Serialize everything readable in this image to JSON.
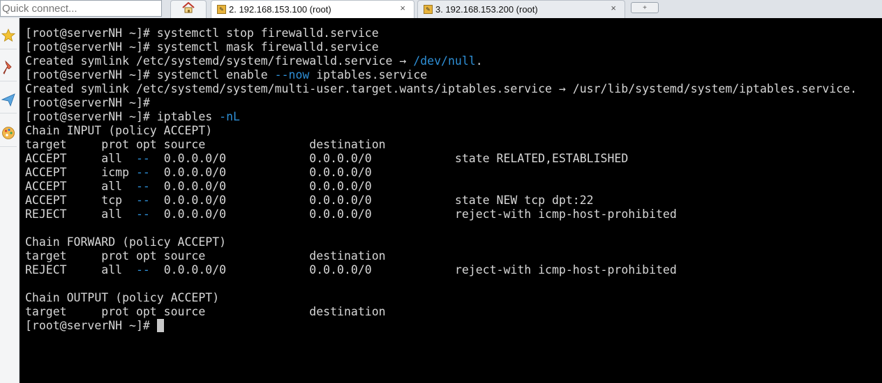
{
  "quick_connect": {
    "placeholder": "Quick connect..."
  },
  "tabs": [
    {
      "label": "2. 192.168.153.100 (root)",
      "close": "×",
      "active": true
    },
    {
      "label": "3. 192.168.153.200 (root)",
      "close": "×",
      "active": false
    }
  ],
  "new_tab_icon": "+",
  "sidebar": {
    "icons": [
      "star-icon",
      "pin-icon",
      "send-icon",
      "palette-icon"
    ]
  },
  "terminal": {
    "prompt": "[root@serverNH ~]# ",
    "lines": [
      {
        "t": "prompt_cmd",
        "cmd": "systemctl stop firewalld.service"
      },
      {
        "t": "prompt_cmd",
        "cmd": "systemctl mask firewalld.service"
      },
      {
        "t": "plain",
        "text": "Created symlink /etc/systemd/system/firewalld.service → ",
        "blue": "/dev/null",
        "after": "."
      },
      {
        "t": "prompt_cmd",
        "cmd_pre": "systemctl enable ",
        "blue": "--now",
        "cmd_post": " iptables.service"
      },
      {
        "t": "plain",
        "text": "Created symlink /etc/systemd/system/multi-user.target.wants/iptables.service → /usr/lib/systemd/system/iptables.service."
      },
      {
        "t": "prompt_cmd",
        "cmd": ""
      },
      {
        "t": "prompt_cmd",
        "cmd_pre": "iptables ",
        "blue": "-nL",
        "cmd_post": ""
      },
      {
        "t": "plain",
        "text": "Chain INPUT (policy ACCEPT)"
      },
      {
        "t": "plain",
        "text": "target     prot opt source               destination"
      },
      {
        "t": "rule",
        "target": "ACCEPT",
        "prot": "all",
        "opt": "--",
        "source": "0.0.0.0/0",
        "dest": "0.0.0.0/0",
        "extra": "state RELATED,ESTABLISHED"
      },
      {
        "t": "rule",
        "target": "ACCEPT",
        "prot": "icmp",
        "opt": "--",
        "source": "0.0.0.0/0",
        "dest": "0.0.0.0/0",
        "extra": ""
      },
      {
        "t": "rule",
        "target": "ACCEPT",
        "prot": "all",
        "opt": "--",
        "source": "0.0.0.0/0",
        "dest": "0.0.0.0/0",
        "extra": ""
      },
      {
        "t": "rule",
        "target": "ACCEPT",
        "prot": "tcp",
        "opt": "--",
        "source": "0.0.0.0/0",
        "dest": "0.0.0.0/0",
        "extra": "state NEW tcp dpt:22"
      },
      {
        "t": "rule",
        "target": "REJECT",
        "prot": "all",
        "opt": "--",
        "source": "0.0.0.0/0",
        "dest": "0.0.0.0/0",
        "extra": "reject-with icmp-host-prohibited"
      },
      {
        "t": "plain",
        "text": ""
      },
      {
        "t": "plain",
        "text": "Chain FORWARD (policy ACCEPT)"
      },
      {
        "t": "plain",
        "text": "target     prot opt source               destination"
      },
      {
        "t": "rule",
        "target": "REJECT",
        "prot": "all",
        "opt": "--",
        "source": "0.0.0.0/0",
        "dest": "0.0.0.0/0",
        "extra": "reject-with icmp-host-prohibited"
      },
      {
        "t": "plain",
        "text": ""
      },
      {
        "t": "plain",
        "text": "Chain OUTPUT (policy ACCEPT)"
      },
      {
        "t": "plain",
        "text": "target     prot opt source               destination"
      },
      {
        "t": "prompt_cursor"
      }
    ]
  },
  "colors": {
    "terminal_bg": "#000000",
    "terminal_fg": "#d7d7d7",
    "highlight_blue": "#2e8fd6"
  }
}
